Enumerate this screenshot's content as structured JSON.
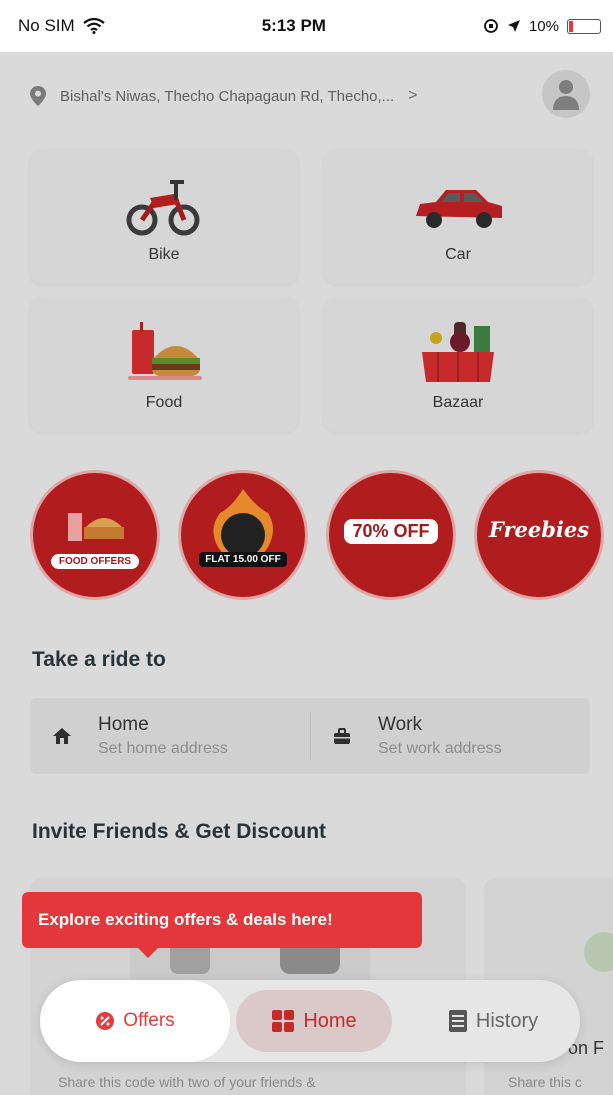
{
  "status_bar": {
    "carrier": "No SIM",
    "time": "5:13 PM",
    "battery": "10%"
  },
  "address": {
    "text": "Bishal's Niwas, Thecho Chapagaun Rd, Thecho,...",
    "chevron": ">"
  },
  "services": [
    {
      "label": "Bike",
      "icon": "motorbike-icon"
    },
    {
      "label": "Car",
      "icon": "car-icon"
    },
    {
      "label": "Food",
      "icon": "burger-drink-icon"
    },
    {
      "label": "Bazaar",
      "icon": "grocery-basket-icon"
    }
  ],
  "promos": [
    {
      "label": "FOOD OFFERS"
    },
    {
      "label": "FLAT 15.00 OFF"
    },
    {
      "label": "70% OFF"
    },
    {
      "label": "Freebies"
    }
  ],
  "ride": {
    "title": "Take a ride to",
    "home": {
      "title": "Home",
      "subtitle": "Set home address"
    },
    "work": {
      "title": "Work",
      "subtitle": "Set work address"
    }
  },
  "invite": {
    "title": "Invite Friends & Get Discount",
    "card1_desc": "Share this code with two of your friends &",
    "card2_title": "on F",
    "card2_desc": "Share this c"
  },
  "tooltip": {
    "text": "Explore exciting offers & deals here!"
  },
  "nav": {
    "offers": "Offers",
    "home": "Home",
    "history": "History"
  },
  "colors": {
    "accent_red": "#e3373c",
    "promo_red": "#b11d1f"
  }
}
